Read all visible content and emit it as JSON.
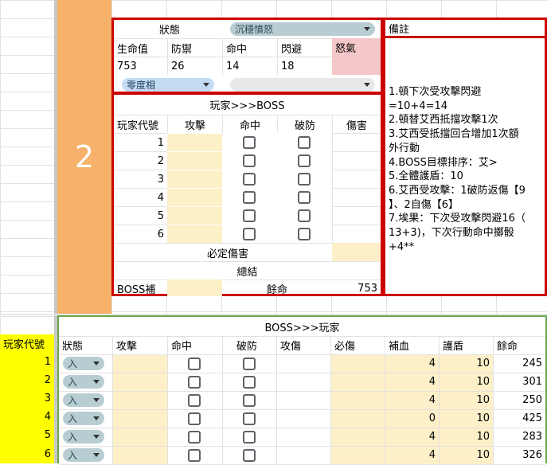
{
  "round_number": "2",
  "status_panel": {
    "status_label": "狀態",
    "status_value": "沉穩憤怒",
    "headers": [
      "生命值",
      "防禦",
      "命中",
      "閃避",
      "怒氣"
    ],
    "values": [
      "753",
      "26",
      "14",
      "18",
      ""
    ],
    "phase_value": "零度相",
    "second_select_value": ""
  },
  "notes": {
    "header": "備註",
    "lines": [
      "1.頓下次受攻擊閃避",
      "=10+4=14",
      "2.頓替艾西抵擋攻擊1次",
      "3.艾西受抵擋回合增加1次額",
      "外行動",
      "4.BOSS目標排序：艾>",
      "5.全體護盾：10",
      "6.艾西受攻擊：1破防返傷【9",
      "】、2自傷【6】",
      "7.埃果：下次受攻擊閃避16（",
      "13+3)，下次行動命中擲骰",
      "+4**"
    ]
  },
  "player_attack": {
    "title": "玩家>>>BOSS",
    "headers": [
      "玩家代號",
      "攻擊",
      "命中",
      "破防",
      "傷害"
    ],
    "rows": [
      "1",
      "2",
      "3",
      "4",
      "5",
      "6"
    ],
    "sure_damage_label": "必定傷害",
    "summary_label": "總結",
    "boss_heal_label": "BOSS補",
    "remaining_label": "餘命",
    "remaining_value": "753"
  },
  "boss_attack": {
    "side_label": "玩家代號",
    "title": "BOSS>>>玩家",
    "headers": [
      "狀態",
      "攻擊",
      "命中",
      "破防",
      "攻傷",
      "必傷",
      "補血",
      "護盾",
      "餘命"
    ],
    "rows": [
      {
        "id": "1",
        "status": "入",
        "heal": "4",
        "shield": "10",
        "hp": "245"
      },
      {
        "id": "2",
        "status": "入",
        "heal": "4",
        "shield": "10",
        "hp": "301"
      },
      {
        "id": "3",
        "status": "入",
        "heal": "4",
        "shield": "10",
        "hp": "250"
      },
      {
        "id": "4",
        "status": "入",
        "heal": "0",
        "shield": "10",
        "hp": "425"
      },
      {
        "id": "5",
        "status": "入",
        "heal": "4",
        "shield": "10",
        "hp": "283"
      },
      {
        "id": "6",
        "status": "入",
        "heal": "4",
        "shield": "10",
        "hp": "326"
      }
    ]
  }
}
